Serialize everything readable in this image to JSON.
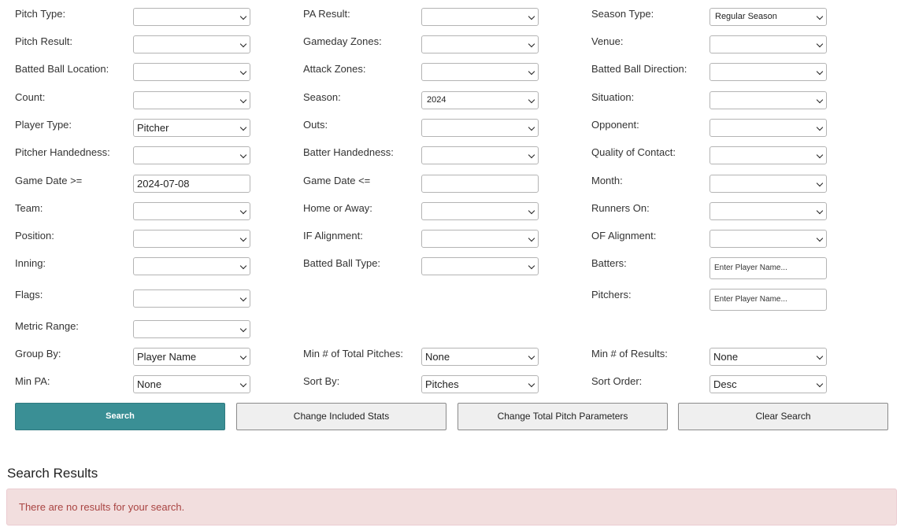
{
  "form": {
    "pitch_type": {
      "label": "Pitch Type:",
      "value": ""
    },
    "pa_result": {
      "label": "PA Result:",
      "value": ""
    },
    "season_type": {
      "label": "Season Type:",
      "value": "Regular Season"
    },
    "pitch_result": {
      "label": "Pitch Result:",
      "value": ""
    },
    "gameday_zones": {
      "label": "Gameday Zones:",
      "value": ""
    },
    "venue": {
      "label": "Venue:",
      "value": ""
    },
    "batted_ball_location": {
      "label": "Batted Ball Location:",
      "value": ""
    },
    "attack_zones": {
      "label": "Attack Zones:",
      "value": ""
    },
    "batted_ball_direction": {
      "label": "Batted Ball Direction:",
      "value": ""
    },
    "count": {
      "label": "Count:",
      "value": ""
    },
    "season": {
      "label": "Season:",
      "value": "2024"
    },
    "situation": {
      "label": "Situation:",
      "value": ""
    },
    "player_type": {
      "label": "Player Type:",
      "value": "Pitcher"
    },
    "outs": {
      "label": "Outs:",
      "value": ""
    },
    "opponent": {
      "label": "Opponent:",
      "value": ""
    },
    "pitcher_handedness": {
      "label": "Pitcher Handedness:",
      "value": ""
    },
    "batter_handedness": {
      "label": "Batter Handedness:",
      "value": ""
    },
    "quality_of_contact": {
      "label": "Quality of Contact:",
      "value": ""
    },
    "game_date_from": {
      "label": "Game Date >=",
      "value": "2024-07-08"
    },
    "game_date_to": {
      "label": "Game Date <=",
      "value": ""
    },
    "month": {
      "label": "Month:",
      "value": ""
    },
    "team": {
      "label": "Team:",
      "value": ""
    },
    "home_or_away": {
      "label": "Home or Away:",
      "value": ""
    },
    "runners_on": {
      "label": "Runners On:",
      "value": ""
    },
    "position": {
      "label": "Position:",
      "value": ""
    },
    "if_alignment": {
      "label": "IF Alignment:",
      "value": ""
    },
    "of_alignment": {
      "label": "OF Alignment:",
      "value": ""
    },
    "inning": {
      "label": "Inning:",
      "value": ""
    },
    "batted_ball_type": {
      "label": "Batted Ball Type:",
      "value": ""
    },
    "batters": {
      "label": "Batters:",
      "placeholder": "Enter Player Name..."
    },
    "flags": {
      "label": "Flags:",
      "value": ""
    },
    "pitchers": {
      "label": "Pitchers:",
      "placeholder": "Enter Player Name..."
    },
    "metric_range": {
      "label": "Metric Range:",
      "value": ""
    },
    "group_by": {
      "label": "Group By:",
      "value": "Player Name"
    },
    "min_total_pitches": {
      "label": "Min # of Total Pitches:",
      "value": "None"
    },
    "min_results": {
      "label": "Min # of Results:",
      "value": "None"
    },
    "min_pa": {
      "label": "Min PA:",
      "value": "None"
    },
    "sort_by": {
      "label": "Sort By:",
      "value": "Pitches"
    },
    "sort_order": {
      "label": "Sort Order:",
      "value": "Desc"
    }
  },
  "buttons": {
    "search": "Search",
    "change_included_stats": "Change Included Stats",
    "change_total_pitch_parameters": "Change Total Pitch Parameters",
    "clear_search": "Clear Search"
  },
  "results": {
    "title": "Search Results",
    "message": "There are no results for your search."
  },
  "colors": {
    "primary_button": "#3a8f95",
    "alert_background": "#f2dede",
    "alert_text": "#a94442"
  }
}
